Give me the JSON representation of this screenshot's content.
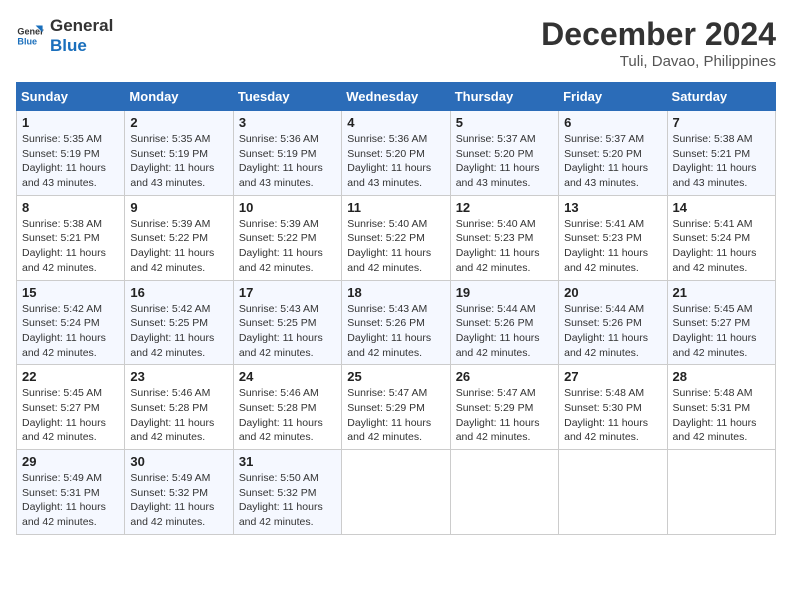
{
  "logo": {
    "text_general": "General",
    "text_blue": "Blue"
  },
  "title": "December 2024",
  "subtitle": "Tuli, Davao, Philippines",
  "weekdays": [
    "Sunday",
    "Monday",
    "Tuesday",
    "Wednesday",
    "Thursday",
    "Friday",
    "Saturday"
  ],
  "weeks": [
    [
      {
        "day": "1",
        "sunrise": "Sunrise: 5:35 AM",
        "sunset": "Sunset: 5:19 PM",
        "daylight": "Daylight: 11 hours and 43 minutes."
      },
      {
        "day": "2",
        "sunrise": "Sunrise: 5:35 AM",
        "sunset": "Sunset: 5:19 PM",
        "daylight": "Daylight: 11 hours and 43 minutes."
      },
      {
        "day": "3",
        "sunrise": "Sunrise: 5:36 AM",
        "sunset": "Sunset: 5:19 PM",
        "daylight": "Daylight: 11 hours and 43 minutes."
      },
      {
        "day": "4",
        "sunrise": "Sunrise: 5:36 AM",
        "sunset": "Sunset: 5:20 PM",
        "daylight": "Daylight: 11 hours and 43 minutes."
      },
      {
        "day": "5",
        "sunrise": "Sunrise: 5:37 AM",
        "sunset": "Sunset: 5:20 PM",
        "daylight": "Daylight: 11 hours and 43 minutes."
      },
      {
        "day": "6",
        "sunrise": "Sunrise: 5:37 AM",
        "sunset": "Sunset: 5:20 PM",
        "daylight": "Daylight: 11 hours and 43 minutes."
      },
      {
        "day": "7",
        "sunrise": "Sunrise: 5:38 AM",
        "sunset": "Sunset: 5:21 PM",
        "daylight": "Daylight: 11 hours and 43 minutes."
      }
    ],
    [
      {
        "day": "8",
        "sunrise": "Sunrise: 5:38 AM",
        "sunset": "Sunset: 5:21 PM",
        "daylight": "Daylight: 11 hours and 42 minutes."
      },
      {
        "day": "9",
        "sunrise": "Sunrise: 5:39 AM",
        "sunset": "Sunset: 5:22 PM",
        "daylight": "Daylight: 11 hours and 42 minutes."
      },
      {
        "day": "10",
        "sunrise": "Sunrise: 5:39 AM",
        "sunset": "Sunset: 5:22 PM",
        "daylight": "Daylight: 11 hours and 42 minutes."
      },
      {
        "day": "11",
        "sunrise": "Sunrise: 5:40 AM",
        "sunset": "Sunset: 5:22 PM",
        "daylight": "Daylight: 11 hours and 42 minutes."
      },
      {
        "day": "12",
        "sunrise": "Sunrise: 5:40 AM",
        "sunset": "Sunset: 5:23 PM",
        "daylight": "Daylight: 11 hours and 42 minutes."
      },
      {
        "day": "13",
        "sunrise": "Sunrise: 5:41 AM",
        "sunset": "Sunset: 5:23 PM",
        "daylight": "Daylight: 11 hours and 42 minutes."
      },
      {
        "day": "14",
        "sunrise": "Sunrise: 5:41 AM",
        "sunset": "Sunset: 5:24 PM",
        "daylight": "Daylight: 11 hours and 42 minutes."
      }
    ],
    [
      {
        "day": "15",
        "sunrise": "Sunrise: 5:42 AM",
        "sunset": "Sunset: 5:24 PM",
        "daylight": "Daylight: 11 hours and 42 minutes."
      },
      {
        "day": "16",
        "sunrise": "Sunrise: 5:42 AM",
        "sunset": "Sunset: 5:25 PM",
        "daylight": "Daylight: 11 hours and 42 minutes."
      },
      {
        "day": "17",
        "sunrise": "Sunrise: 5:43 AM",
        "sunset": "Sunset: 5:25 PM",
        "daylight": "Daylight: 11 hours and 42 minutes."
      },
      {
        "day": "18",
        "sunrise": "Sunrise: 5:43 AM",
        "sunset": "Sunset: 5:26 PM",
        "daylight": "Daylight: 11 hours and 42 minutes."
      },
      {
        "day": "19",
        "sunrise": "Sunrise: 5:44 AM",
        "sunset": "Sunset: 5:26 PM",
        "daylight": "Daylight: 11 hours and 42 minutes."
      },
      {
        "day": "20",
        "sunrise": "Sunrise: 5:44 AM",
        "sunset": "Sunset: 5:26 PM",
        "daylight": "Daylight: 11 hours and 42 minutes."
      },
      {
        "day": "21",
        "sunrise": "Sunrise: 5:45 AM",
        "sunset": "Sunset: 5:27 PM",
        "daylight": "Daylight: 11 hours and 42 minutes."
      }
    ],
    [
      {
        "day": "22",
        "sunrise": "Sunrise: 5:45 AM",
        "sunset": "Sunset: 5:27 PM",
        "daylight": "Daylight: 11 hours and 42 minutes."
      },
      {
        "day": "23",
        "sunrise": "Sunrise: 5:46 AM",
        "sunset": "Sunset: 5:28 PM",
        "daylight": "Daylight: 11 hours and 42 minutes."
      },
      {
        "day": "24",
        "sunrise": "Sunrise: 5:46 AM",
        "sunset": "Sunset: 5:28 PM",
        "daylight": "Daylight: 11 hours and 42 minutes."
      },
      {
        "day": "25",
        "sunrise": "Sunrise: 5:47 AM",
        "sunset": "Sunset: 5:29 PM",
        "daylight": "Daylight: 11 hours and 42 minutes."
      },
      {
        "day": "26",
        "sunrise": "Sunrise: 5:47 AM",
        "sunset": "Sunset: 5:29 PM",
        "daylight": "Daylight: 11 hours and 42 minutes."
      },
      {
        "day": "27",
        "sunrise": "Sunrise: 5:48 AM",
        "sunset": "Sunset: 5:30 PM",
        "daylight": "Daylight: 11 hours and 42 minutes."
      },
      {
        "day": "28",
        "sunrise": "Sunrise: 5:48 AM",
        "sunset": "Sunset: 5:31 PM",
        "daylight": "Daylight: 11 hours and 42 minutes."
      }
    ],
    [
      {
        "day": "29",
        "sunrise": "Sunrise: 5:49 AM",
        "sunset": "Sunset: 5:31 PM",
        "daylight": "Daylight: 11 hours and 42 minutes."
      },
      {
        "day": "30",
        "sunrise": "Sunrise: 5:49 AM",
        "sunset": "Sunset: 5:32 PM",
        "daylight": "Daylight: 11 hours and 42 minutes."
      },
      {
        "day": "31",
        "sunrise": "Sunrise: 5:50 AM",
        "sunset": "Sunset: 5:32 PM",
        "daylight": "Daylight: 11 hours and 42 minutes."
      },
      null,
      null,
      null,
      null
    ]
  ]
}
